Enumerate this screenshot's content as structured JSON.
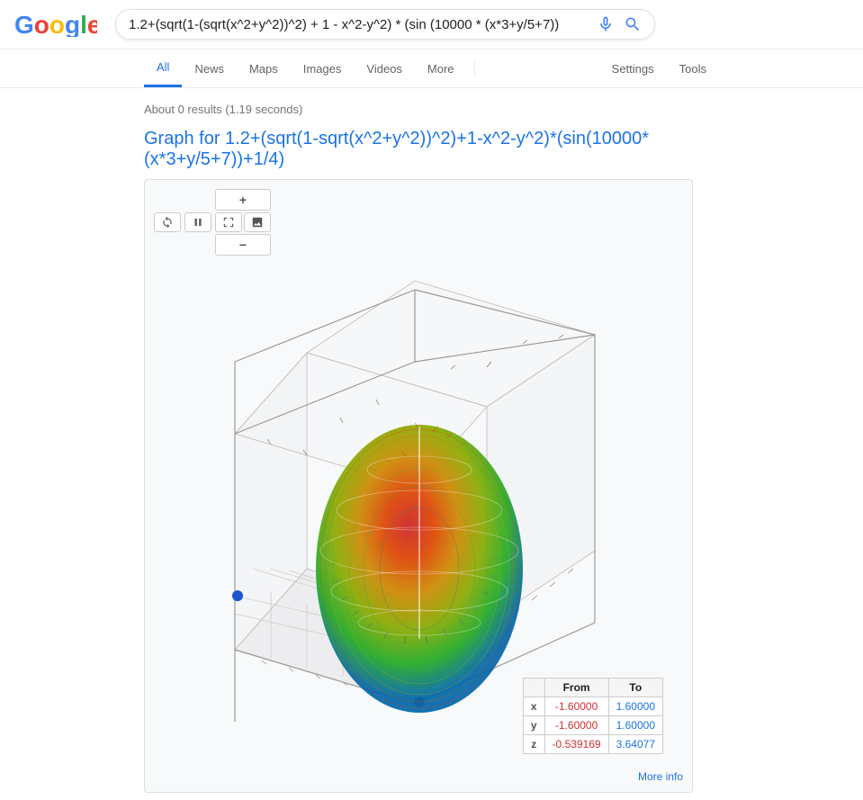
{
  "header": {
    "search_query": "1.2+(sqrt(1-(sqrt(x^2+y^2))^2) + 1 - x^2-y^2) * (sin (10000 * (x*3+y/5+7))",
    "search_placeholder": "Search"
  },
  "nav": {
    "items": [
      {
        "label": "All",
        "active": true
      },
      {
        "label": "News",
        "active": false
      },
      {
        "label": "Maps",
        "active": false
      },
      {
        "label": "Images",
        "active": false
      },
      {
        "label": "Videos",
        "active": false
      },
      {
        "label": "More",
        "active": false
      }
    ],
    "right_items": [
      {
        "label": "Settings"
      },
      {
        "label": "Tools"
      }
    ]
  },
  "results": {
    "stats": "About 0 results (1.19 seconds)",
    "graph": {
      "heading_prefix": "Graph for ",
      "heading_formula": "1.2+(sqrt(1-sqrt(x^2+y^2))^2)+1-x^2-y^2)*(sin(10000*(x*3+y/5+7))+1/4)",
      "controls": {
        "rotate": "↺",
        "pause": "⏸",
        "zoom_in": "+",
        "fullscreen": "⛶",
        "zoom_out": "−"
      }
    },
    "range_table": {
      "headers": [
        "",
        "From",
        "To"
      ],
      "rows": [
        {
          "label": "x",
          "from": "-1.60000",
          "to": "1.60000"
        },
        {
          "label": "y",
          "from": "-1.60000",
          "to": "1.60000"
        },
        {
          "label": "z",
          "from": "-0.539169",
          "to": "3.64077"
        }
      ]
    },
    "more_info": "More info"
  }
}
